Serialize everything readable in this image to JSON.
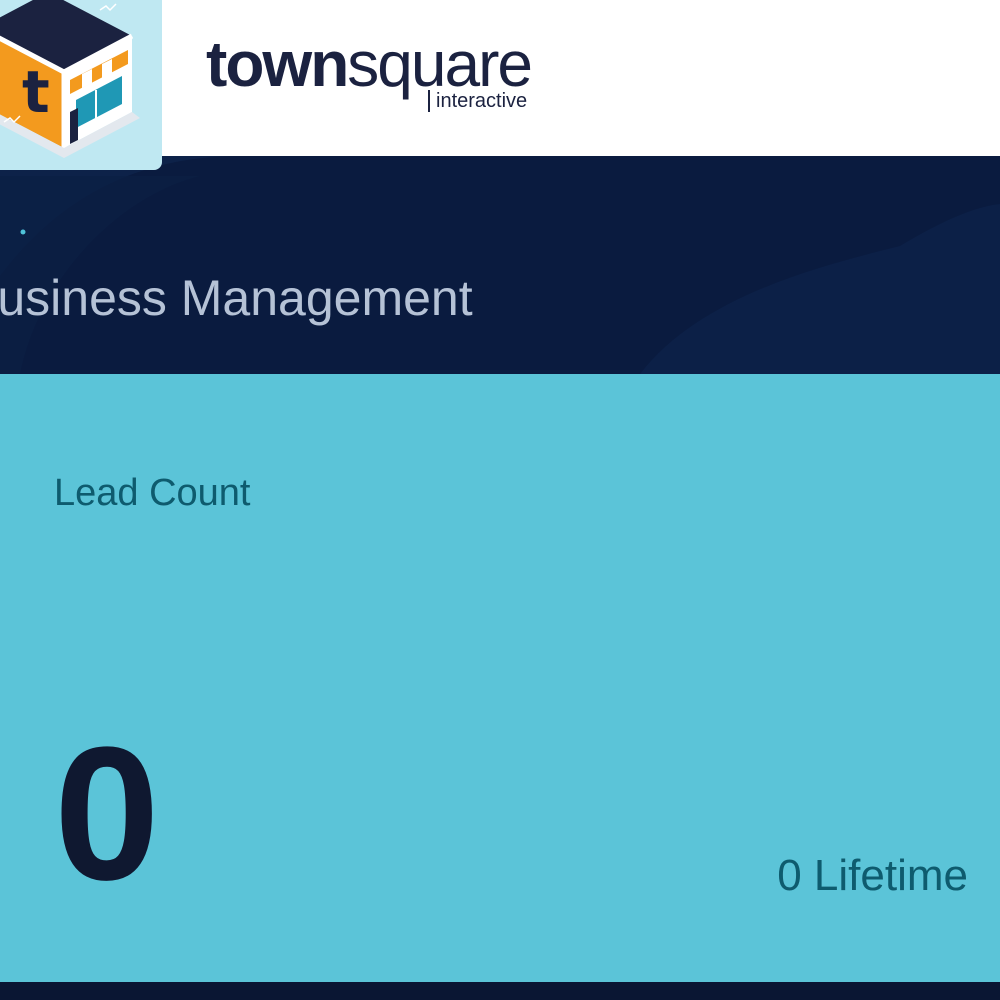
{
  "brand": {
    "wordmark_bold": "town",
    "wordmark_light": "square",
    "wordmark_sub": "interactive",
    "logo_letter": "t",
    "logo_icon": "store-cube-logo"
  },
  "banner": {
    "title": "Business Management"
  },
  "lead_card": {
    "title": "Lead Count",
    "count": "0",
    "lifetime": "0 Lifetime"
  },
  "colors": {
    "banner_bg": "#0a1b3f",
    "card_bg": "#5bc4d8",
    "card_text": "#0e5b6e",
    "count_text": "#0f1830",
    "logo_orange": "#f39a1e",
    "logo_tile": "#bfe8f2"
  }
}
